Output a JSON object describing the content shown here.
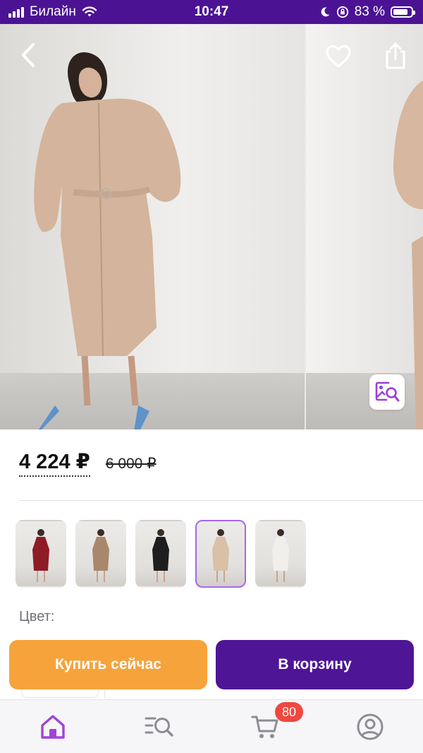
{
  "status_bar": {
    "carrier": "Билайн",
    "time": "10:47",
    "battery": "83 %",
    "battery_level": 0.83
  },
  "product": {
    "price_current": "4 224 ₽",
    "price_old": "6 000 ₽"
  },
  "color_section": {
    "label": "Цвет:",
    "selected_index": 3,
    "options": [
      {
        "color": "#8e1c27"
      },
      {
        "color": "#a8876b"
      },
      {
        "color": "#1e1d1f"
      },
      {
        "color": "#d9c0a6"
      },
      {
        "color": "#f1efec"
      }
    ]
  },
  "actions": {
    "buy_now": "Купить сейчас",
    "add_to_cart": "В корзину"
  },
  "tab_bar": {
    "cart_badge": "80",
    "accent_color": "#a043d8",
    "inactive_color": "#8d8d93"
  },
  "colors": {
    "brand_purple": "#4e1597",
    "buy_orange": "#f6a33c"
  }
}
